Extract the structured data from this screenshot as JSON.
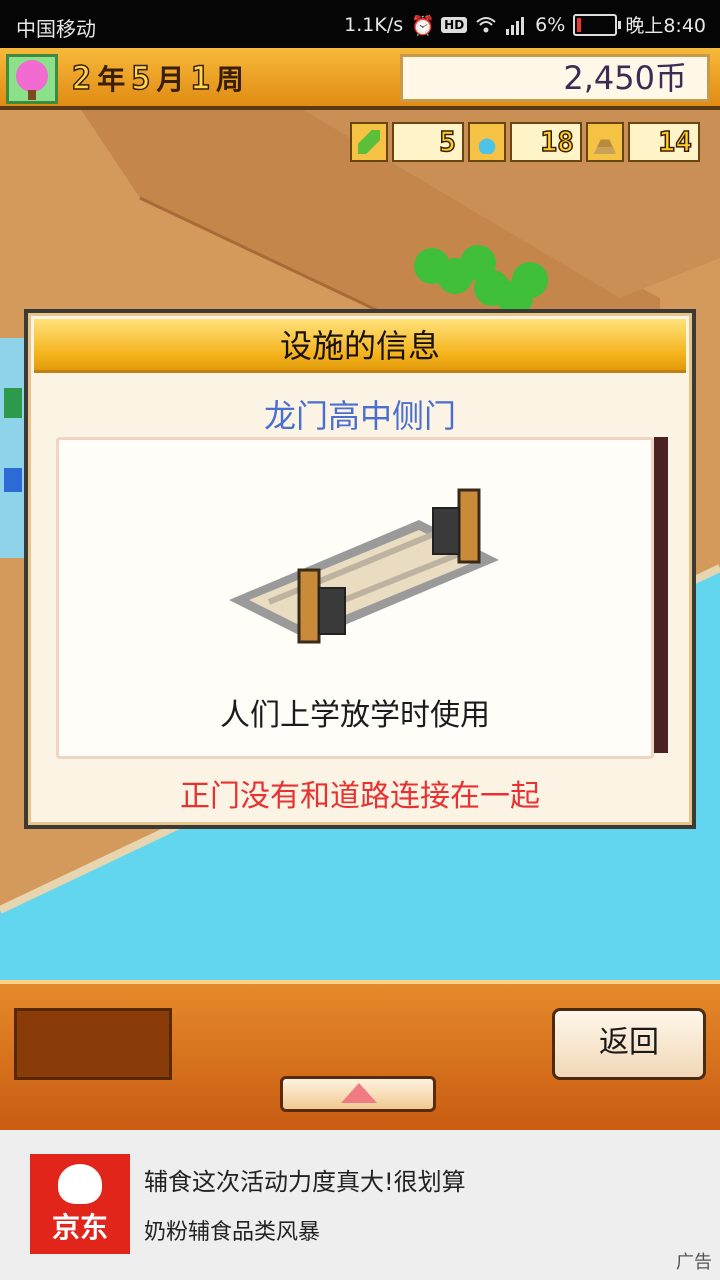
{
  "status_bar": {
    "carrier": "中国移动",
    "net_speed": "1.1K/s",
    "hd": "HD",
    "battery": "6%",
    "time": "晚上8:40"
  },
  "hud": {
    "year": "2",
    "year_unit": "年",
    "month": "5",
    "month_unit": "月",
    "week": "1",
    "week_unit": "周",
    "money": "2,450币",
    "resources": [
      {
        "icon": "pencil-icon",
        "value": "5"
      },
      {
        "icon": "flask-icon",
        "value": "18"
      },
      {
        "icon": "pyramid-icon",
        "value": "14"
      }
    ]
  },
  "dialog": {
    "title": "设施的信息",
    "facility_name": "龙门高中侧门",
    "description": "人们上学放学时使用",
    "warning": "正门没有和道路连接在一起"
  },
  "bottom": {
    "back_label": "返回"
  },
  "ad": {
    "brand": "京东",
    "title": "辅食这次活动力度真大!很划算",
    "subtitle": "奶粉辅食品类风暴",
    "tag": "广告"
  }
}
